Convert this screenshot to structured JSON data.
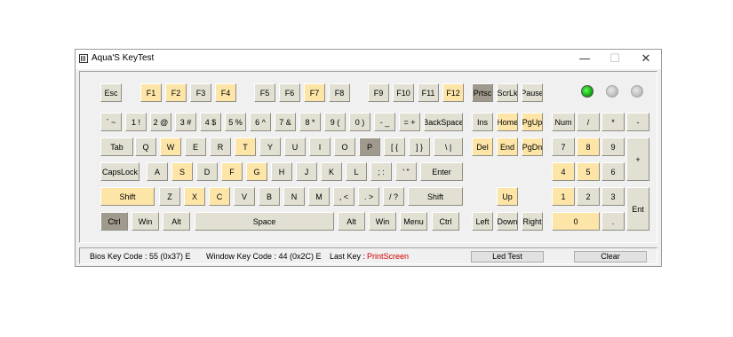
{
  "window": {
    "title": "Aqua'S KeyTest",
    "icon": "keyboard-icon",
    "controls": {
      "minimize": "—",
      "maximize": "☐",
      "close": "✕"
    }
  },
  "colors": {
    "pressed": "#fde5a8",
    "active": "#a09a8e",
    "key": "#e1e0d2",
    "led_on": "#16c016",
    "red_text": "#d40000"
  },
  "leds": [
    "on",
    "off",
    "off"
  ],
  "keys": {
    "esc": "Esc",
    "f1": "F1",
    "f2": "F2",
    "f3": "F3",
    "f4": "F4",
    "f5": "F5",
    "f6": "F6",
    "f7": "F7",
    "f8": "F8",
    "f9": "F9",
    "f10": "F10",
    "f11": "F11",
    "f12": "F12",
    "prtsc": "Prtsc",
    "scrlk": "ScrLk",
    "pause": "Pause",
    "tilde": "` ~",
    "1": "1 !",
    "2": "2 @",
    "3": "3 #",
    "4": "4 $",
    "5": "5 %",
    "6": "6 ^",
    "7": "7 &",
    "8": "8 *",
    "9": "9 (",
    "0": "0 )",
    "minus": "- _",
    "equal": "= +",
    "backspace": "BackSpace",
    "ins": "Ins",
    "home": "Home",
    "pgup": "PgUp",
    "num": "Num",
    "kp_div": "/",
    "kp_mul": "*",
    "kp_minus": "-",
    "tab": "Tab",
    "q": "Q",
    "w": "W",
    "e": "E",
    "r": "R",
    "t": "T",
    "y": "Y",
    "u": "U",
    "i": "I",
    "o": "O",
    "p": "P",
    "lbracket": "[ {",
    "rbracket": "] }",
    "backslash": "\\ |",
    "del": "Del",
    "end": "End",
    "pgdn": "PgDn",
    "kp7": "7",
    "kp8": "8",
    "kp9": "9",
    "kp_plus": "+",
    "capslock": "CapsLock",
    "a": "A",
    "s": "S",
    "d": "D",
    "f": "F",
    "g": "G",
    "h": "H",
    "j": "J",
    "k": "K",
    "l": "L",
    "semicolon": "; :",
    "quote": "' \"",
    "enter": "Enter",
    "kp4": "4",
    "kp5": "5",
    "kp6": "6",
    "lshift": "Shift",
    "z": "Z",
    "x": "X",
    "c": "C",
    "v": "V",
    "b": "B",
    "n": "N",
    "m": "M",
    "comma": ", <",
    "period": ". >",
    "slash": "/ ?",
    "rshift": "Shift",
    "up": "Up",
    "kp1": "1",
    "kp2": "2",
    "kp3": "3",
    "kp_enter": "Ent",
    "lctrl": "Ctrl",
    "lwin": "Win",
    "lalt": "Alt",
    "space": "Space",
    "ralt": "Alt",
    "rwin": "Win",
    "menu": "Menu",
    "rctrl": "Ctrl",
    "left": "Left",
    "down": "Down",
    "right": "Right",
    "kp0": "0",
    "kp_dot": "."
  },
  "pressed": [
    "f1",
    "f2",
    "f4",
    "f7",
    "f12",
    "w",
    "t",
    "s",
    "f",
    "g",
    "x",
    "c",
    "del",
    "end",
    "pgdn",
    "home",
    "pgup",
    "kp8",
    "kp4",
    "kp5",
    "lshift",
    "up",
    "kp1",
    "kp0"
  ],
  "active": [
    "prtsc",
    "p",
    "lctrl"
  ],
  "status": {
    "bios": "Bios Key Code : 55 (0x37) E",
    "window_code": "Window Key Code : 44 (0x2C) E",
    "last_key_label": "Last Key :",
    "last_key": "PrintScreen",
    "led_test": "Led Test",
    "clear": "Clear"
  }
}
